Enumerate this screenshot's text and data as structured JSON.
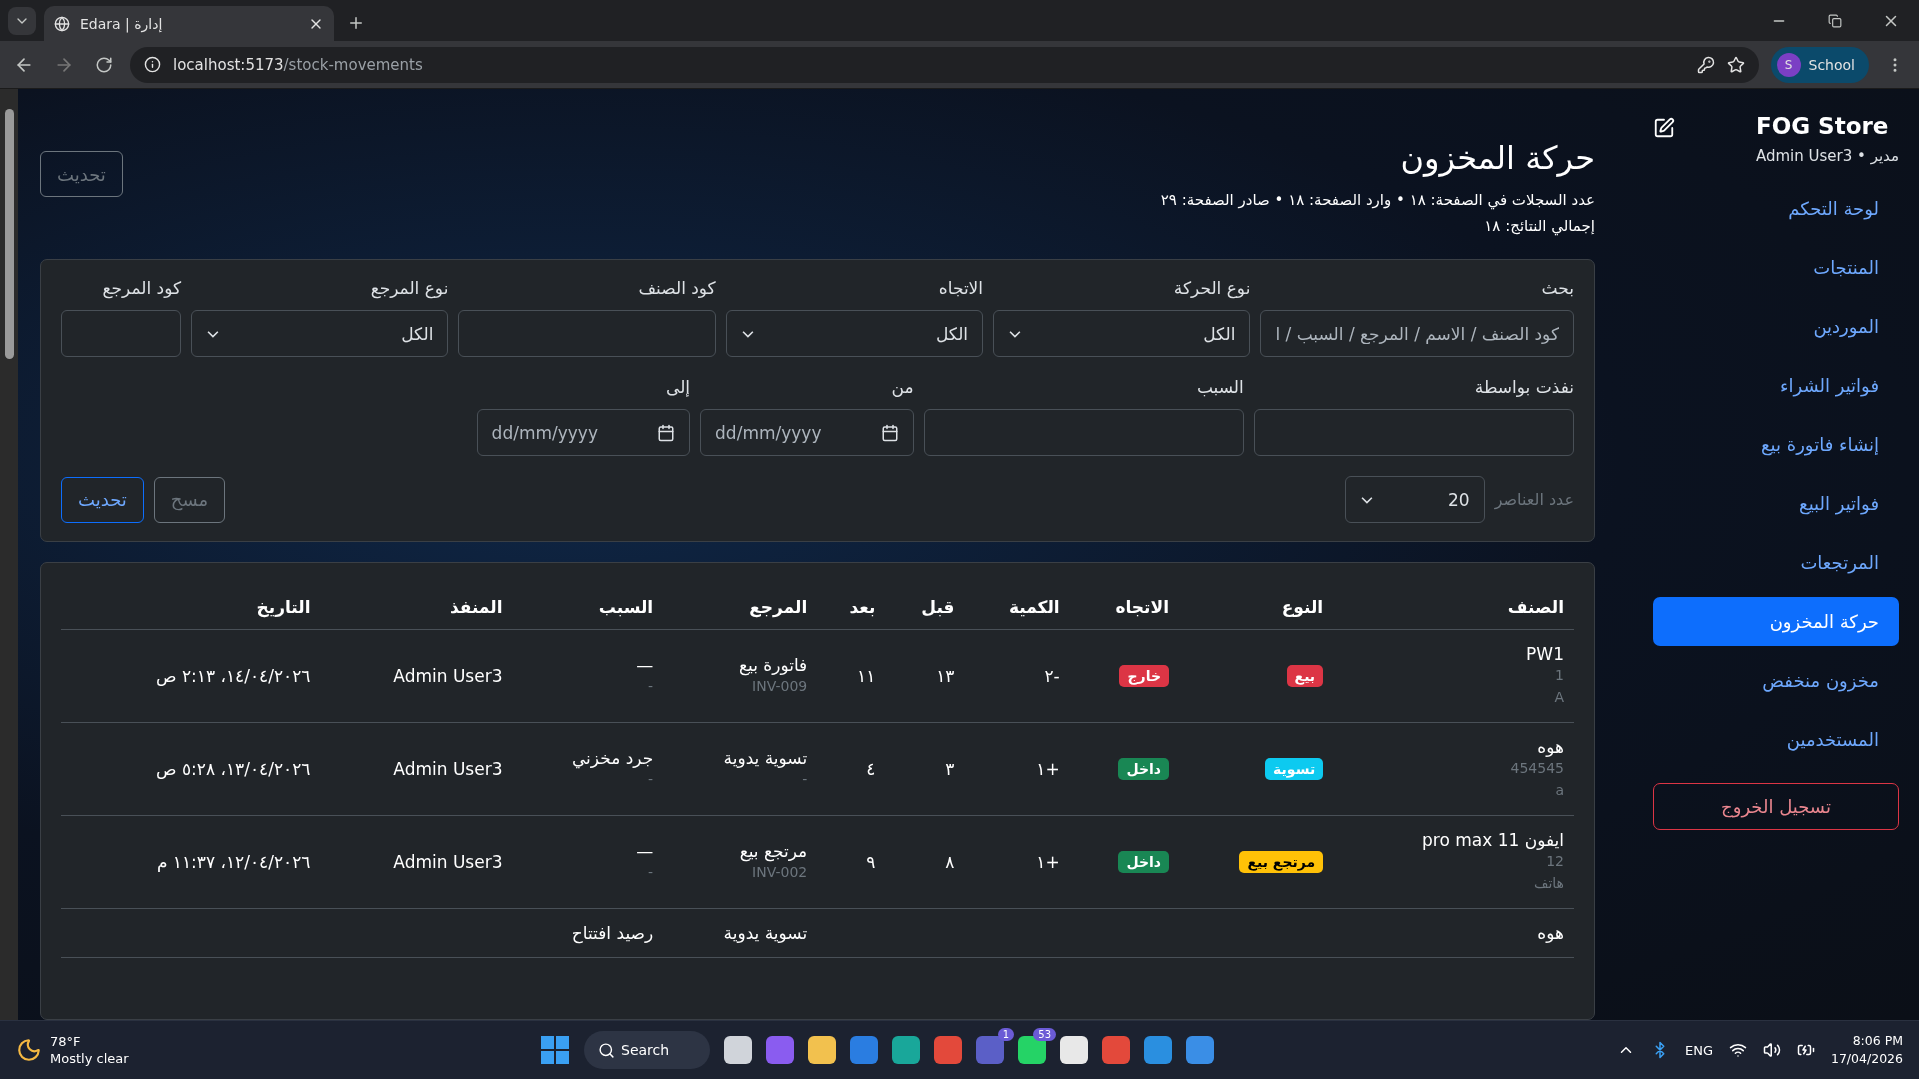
{
  "browser": {
    "tab_title": "Edara | إدارة",
    "url_host": "localhost:5173",
    "url_path": "/stock-movements",
    "profile_initial": "S",
    "profile": "School"
  },
  "sidebar": {
    "store": "FOG Store",
    "user": "مدير • Admin User3",
    "items": [
      {
        "label": "لوحة التحكم",
        "selected": false
      },
      {
        "label": "المنتجات",
        "selected": false
      },
      {
        "label": "الموردين",
        "selected": false
      },
      {
        "label": "فواتير الشراء",
        "selected": false
      },
      {
        "label": "إنشاء فاتورة بيع",
        "selected": false
      },
      {
        "label": "فواتير البيع",
        "selected": false
      },
      {
        "label": "المرتجعات",
        "selected": false
      },
      {
        "label": "حركة المخزون",
        "selected": true
      },
      {
        "label": "مخزون منخفض",
        "selected": false
      },
      {
        "label": "المستخدمين",
        "selected": false
      }
    ],
    "logout": "تسجيل الخروج"
  },
  "header": {
    "title": "حركة المخزون",
    "stats": "عدد السجلات في الصفحة: ١٨ • وارد الصفحة: ١٨ • صادر الصفحة: ٢٩",
    "total": "إجمالي النتائج: ١٨",
    "refresh": "تحديث"
  },
  "filters": {
    "row1": [
      {
        "kind": "text",
        "label": "بحث",
        "placeholder": "كود الصنف / الاسم / المرجع / السبب / ا"
      },
      {
        "kind": "select",
        "label": "نوع الحركة",
        "value": "الكل"
      },
      {
        "kind": "select",
        "label": "الاتجاه",
        "value": "الكل"
      },
      {
        "kind": "text",
        "label": "كود الصنف"
      },
      {
        "kind": "select",
        "label": "نوع المرجع",
        "value": "الكل"
      },
      {
        "kind": "text",
        "label": "كود المرجع"
      }
    ],
    "row2": [
      {
        "kind": "text",
        "label": "نفذت بواسطة"
      },
      {
        "kind": "text",
        "label": "السبب"
      },
      {
        "kind": "date",
        "label": "من",
        "placeholder": "dd/mm/yyyy"
      },
      {
        "kind": "date",
        "label": "إلى",
        "placeholder": "dd/mm/yyyy"
      }
    ],
    "page_size_label": "عدد العناصر",
    "page_size": "20",
    "clear": "مسح",
    "refresh": "تحديث"
  },
  "table": {
    "columns": [
      "الصنف",
      "النوع",
      "الاتجاه",
      "الكمية",
      "قبل",
      "بعد",
      "المرجع",
      "السبب",
      "المنفذ",
      "التاريخ"
    ],
    "rows": [
      {
        "name": "PW1",
        "code": "1",
        "category": "A",
        "type": {
          "label": "بيع",
          "color": "#dc3545"
        },
        "direction": {
          "label": "خارج",
          "color": "#dc3545"
        },
        "qty": "-٢",
        "before": "١٣",
        "after": "١١",
        "reference": "فاتورة بيع",
        "reference_no": "INV-009",
        "reason": "—",
        "reason_note": "-",
        "by": "Admin User3",
        "date": "١٤/٠٤/٢٠٢٦، ٢:١٣ ص"
      },
      {
        "name": "هوه",
        "code": "454545",
        "category": "a",
        "type": {
          "label": "تسوية",
          "color": "#0dcaf0"
        },
        "direction": {
          "label": "داخل",
          "color": "#198754"
        },
        "qty": "+١",
        "before": "٣",
        "after": "٤",
        "reference": "تسوية يدوية",
        "reference_no": "-",
        "reason": "جرد مخزني",
        "reason_note": "-",
        "by": "Admin User3",
        "date": "١٣/٠٤/٢٠٢٦، ٥:٢٨ ص"
      },
      {
        "name": "ايفون 11 pro max",
        "code": "12",
        "category": "هاتف",
        "type": {
          "label": "مرتجع بيع",
          "color": "#ffc107"
        },
        "direction": {
          "label": "داخل",
          "color": "#198754"
        },
        "qty": "+١",
        "before": "٨",
        "after": "٩",
        "reference": "مرتجع بيع",
        "reference_no": "INV-002",
        "reason": "—",
        "reason_note": "-",
        "by": "Admin User3",
        "date": "١٢/٠٤/٢٠٢٦، ١١:٣٧ م"
      },
      {
        "name": "هوه",
        "reference": "تسوية يدوية",
        "reason": "رصيد افتتاح"
      }
    ]
  },
  "taskbar": {
    "temperature": "78°F",
    "weather": "Mostly clear",
    "search": "Search",
    "teams_badge": "1",
    "whatsapp_badge": "53",
    "language": "ENG",
    "time": "8:06 PM",
    "date": "17/04/2026"
  }
}
